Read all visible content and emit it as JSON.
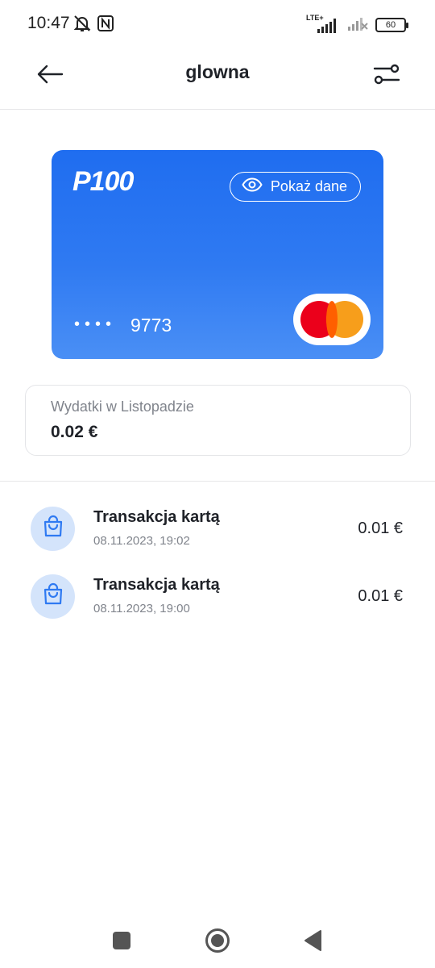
{
  "status_bar": {
    "time": "10:47",
    "network": "LTE+",
    "battery": "60"
  },
  "header": {
    "title": "glowna",
    "back_icon": "arrow-left-icon",
    "filter_icon": "sliders-icon"
  },
  "card": {
    "logo": "P100",
    "show_data_label": "Pokaż dane",
    "masked_dots": "••••",
    "last4": "9773",
    "network_brand": "mastercard",
    "color_top": "#1f6df0",
    "color_bottom": "#4a8ff5"
  },
  "spending": {
    "label": "Wydatki w Listopadzie",
    "value": "0.02 €"
  },
  "transactions": [
    {
      "title": "Transakcja kartą",
      "date": "08.11.2023, 19:02",
      "amount": "0.01 €",
      "icon": "shopping-bag-icon"
    },
    {
      "title": "Transakcja kartą",
      "date": "08.11.2023, 19:00",
      "amount": "0.01 €",
      "icon": "shopping-bag-icon"
    }
  ],
  "nav": {
    "items": [
      "recents-square-icon",
      "home-circle-icon",
      "back-triangle-icon"
    ]
  },
  "colors": {
    "accent": "#2f7af2",
    "icon_bg": "#d4e4fb",
    "text_primary": "#1f2228",
    "text_secondary": "#80848c"
  }
}
